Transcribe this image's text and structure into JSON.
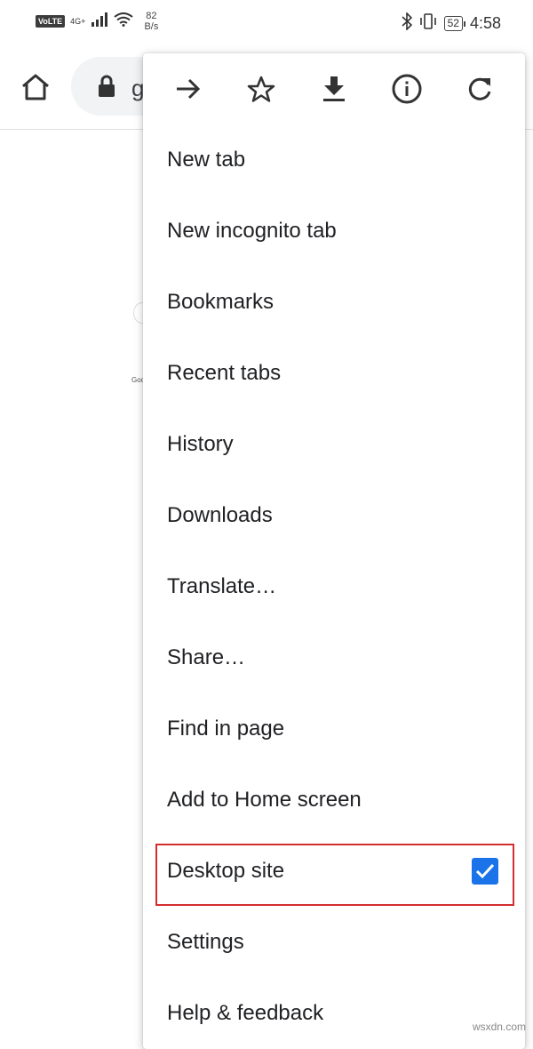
{
  "status_bar": {
    "volte": "VoLTE",
    "network": "4G+",
    "speed_value": "82",
    "speed_unit": "B/s",
    "battery": "52",
    "time": "4:58"
  },
  "toolbar": {
    "url_partial": "g"
  },
  "background": {
    "tiny_text": "Goo"
  },
  "menu": {
    "icons": [
      "forward-icon",
      "bookmark-star-icon",
      "download-icon",
      "info-icon",
      "refresh-icon"
    ],
    "items": [
      {
        "label": "New tab"
      },
      {
        "label": "New incognito tab"
      },
      {
        "label": "Bookmarks"
      },
      {
        "label": "Recent tabs"
      },
      {
        "label": "History"
      },
      {
        "label": "Downloads"
      },
      {
        "label": "Translate…"
      },
      {
        "label": "Share…"
      },
      {
        "label": "Find in page"
      },
      {
        "label": "Add to Home screen"
      },
      {
        "label": "Desktop site",
        "checked": true
      },
      {
        "label": "Settings"
      },
      {
        "label": "Help & feedback"
      }
    ]
  },
  "colors": {
    "checkbox_accent": "#1a73e8",
    "highlight_border": "#d32f2f"
  },
  "watermark": "wsxdn.com"
}
